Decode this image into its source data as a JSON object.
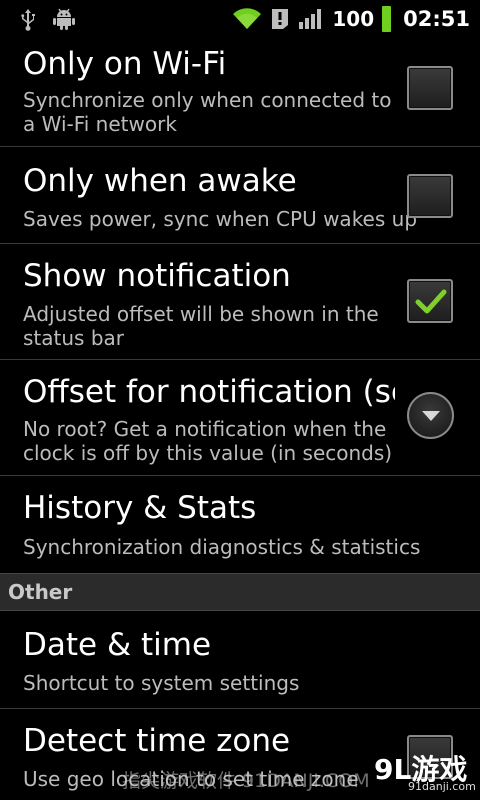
{
  "status_bar": {
    "battery_percent": "100",
    "time": "02:51",
    "icons": [
      "usb-icon",
      "android-debug-icon",
      "wifi-icon",
      "alert-icon",
      "signal-icon",
      "battery-icon"
    ]
  },
  "settings": [
    {
      "title": "Only on Wi-Fi",
      "summary": "Synchronize only when connected to a Wi-Fi network",
      "control": "checkbox",
      "checked": false
    },
    {
      "title": "Only when awake",
      "summary": "Saves power, sync when CPU wakes up",
      "control": "checkbox",
      "checked": false
    },
    {
      "title": "Show notification",
      "summary": "Adjusted offset will be shown in the status bar",
      "control": "checkbox",
      "checked": true
    },
    {
      "title": "Offset for notification (se",
      "summary": "No root? Get a notification when the clock is off by this value (in seconds)",
      "control": "dropdown"
    },
    {
      "title": "History & Stats",
      "summary": "Synchronization diagnostics & statistics",
      "control": "none"
    }
  ],
  "category_other": "Other",
  "other_settings": [
    {
      "title": "Date & time",
      "summary": "Shortcut to system settings",
      "control": "none"
    },
    {
      "title": "Detect time zone",
      "summary": "Use geo location to set time zone",
      "control": "checkbox",
      "checked": false
    }
  ],
  "watermark": {
    "text": "指尖游戏软件 91DANJI.COM",
    "logo": "9L游戏",
    "logo_url": "91danji.com"
  },
  "colors": {
    "background": "#000000",
    "check_green": "#7fd12a",
    "summary_text": "#bcbcbc",
    "category_bg": "#2b2b2b"
  }
}
